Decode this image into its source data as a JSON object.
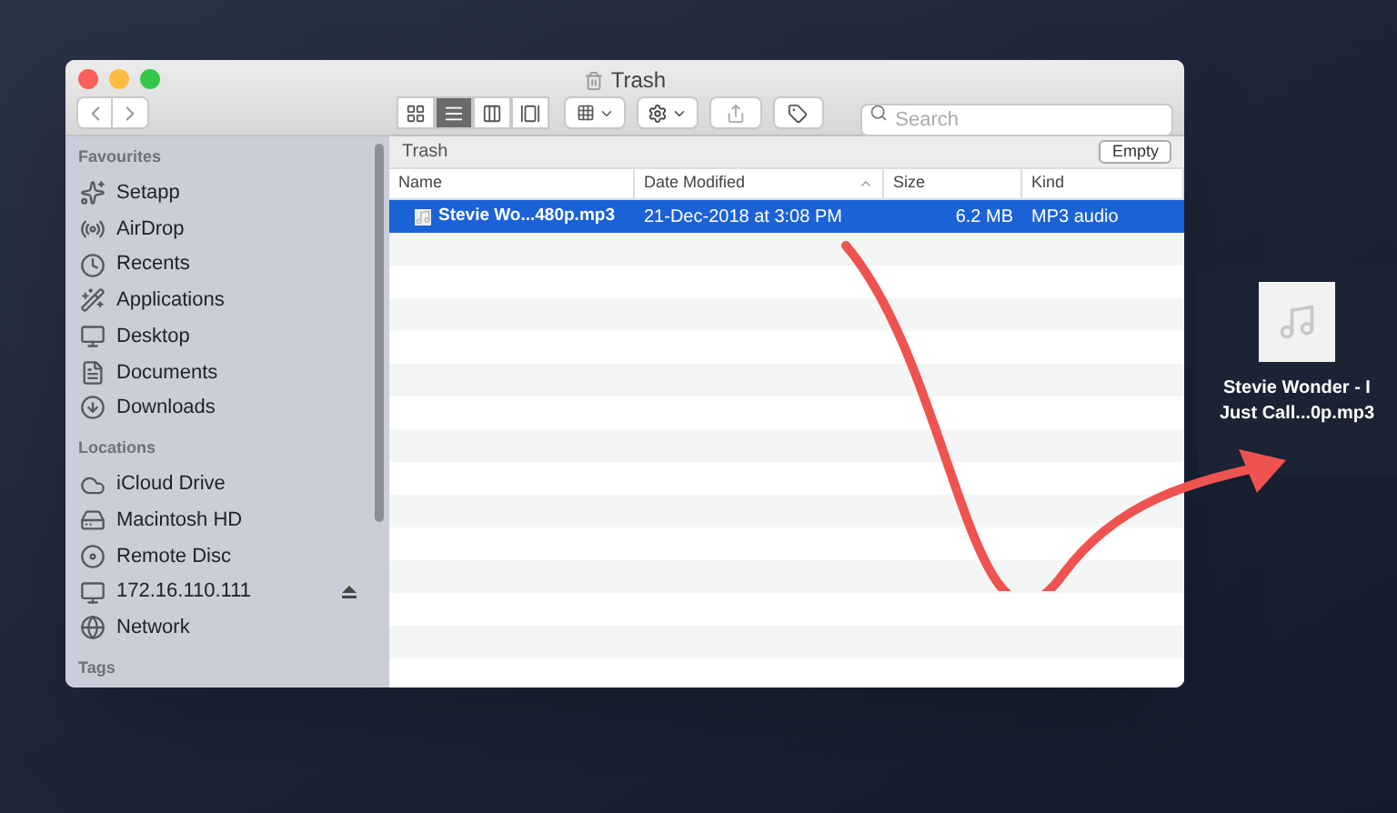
{
  "window": {
    "title": "Trash"
  },
  "toolbar": {
    "view_buttons": [
      {
        "kind": "icons",
        "selected": false
      },
      {
        "kind": "list",
        "selected": true
      },
      {
        "kind": "columns",
        "selected": false
      },
      {
        "kind": "gallery",
        "selected": false
      }
    ],
    "search": {
      "placeholder": "Search"
    }
  },
  "sidebar": {
    "sections": [
      {
        "heading": "Favourites",
        "items": [
          {
            "label": "Setapp",
            "kind": "setapp"
          },
          {
            "label": "AirDrop",
            "kind": "airdrop"
          },
          {
            "label": "Recents",
            "kind": "recents"
          },
          {
            "label": "Applications",
            "kind": "applications"
          },
          {
            "label": "Desktop",
            "kind": "desktop"
          },
          {
            "label": "Documents",
            "kind": "documents"
          },
          {
            "label": "Downloads",
            "kind": "downloads"
          }
        ]
      },
      {
        "heading": "Locations",
        "items": [
          {
            "label": "iCloud Drive",
            "kind": "cloud"
          },
          {
            "label": "Macintosh HD",
            "kind": "disk"
          },
          {
            "label": "Remote Disc",
            "kind": "disc"
          },
          {
            "label": "172.16.110.111",
            "kind": "server",
            "ejectable": true
          },
          {
            "label": "Network",
            "kind": "network"
          }
        ]
      },
      {
        "heading": "Tags"
      }
    ]
  },
  "content": {
    "title": "Trash",
    "empty_button": "Empty",
    "columns": [
      "Name",
      "Date Modified",
      "Size",
      "Kind"
    ],
    "rows": [
      {
        "name": "Stevie Wo...480p.mp3",
        "date": "21-Dec-2018 at 3:08 PM",
        "size": "6.2 MB",
        "kind": "MP3 audio",
        "selected": true
      }
    ]
  },
  "desktop_file": {
    "lines": [
      "Stevie Wonder - I",
      "Just Call...0p.mp3"
    ]
  }
}
